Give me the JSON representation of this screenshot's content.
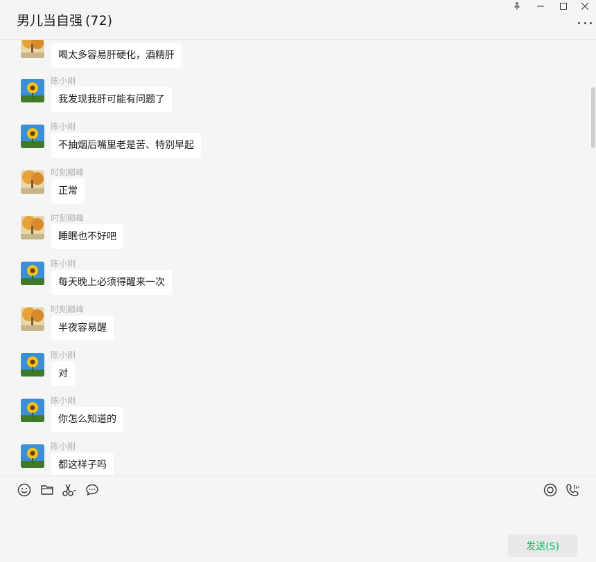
{
  "window": {
    "title": "男儿当自强",
    "member_count": "(72)"
  },
  "messages": [
    {
      "sender": "",
      "text": "喝太多容易肝硬化，酒精肝",
      "avatar": "autumn-tree-avatar"
    },
    {
      "sender": "陈小刚",
      "text": "我发现我肝可能有问题了",
      "avatar": "sunflower-avatar"
    },
    {
      "sender": "陈小刚",
      "text": "不抽烟后嘴里老是苦、特别早起",
      "avatar": "sunflower-avatar"
    },
    {
      "sender": "时刻巅峰",
      "text": "正常",
      "avatar": "autumn-tree-avatar"
    },
    {
      "sender": "时刻巅峰",
      "text": "睡眠也不好吧",
      "avatar": "autumn-tree-avatar"
    },
    {
      "sender": "陈小刚",
      "text": "每天晚上必须得醒来一次",
      "avatar": "sunflower-avatar"
    },
    {
      "sender": "时刻巅峰",
      "text": "半夜容易醒",
      "avatar": "autumn-tree-avatar"
    },
    {
      "sender": "陈小刚",
      "text": "对",
      "avatar": "sunflower-avatar"
    },
    {
      "sender": "陈小刚",
      "text": "你怎么知道的",
      "avatar": "sunflower-avatar"
    },
    {
      "sender": "陈小刚",
      "text": "都这样子吗",
      "avatar": "sunflower-avatar"
    }
  ],
  "toolbar": {
    "left_icons": [
      "emoji-icon",
      "folder-icon",
      "scissors-icon",
      "chat-history-icon"
    ],
    "right_icons": [
      "live-icon",
      "voice-call-icon"
    ]
  },
  "send_button": {
    "label": "发送(S)"
  },
  "colors": {
    "send_text": "#07c160",
    "background": "#f5f5f5",
    "bubble": "#ffffff"
  }
}
